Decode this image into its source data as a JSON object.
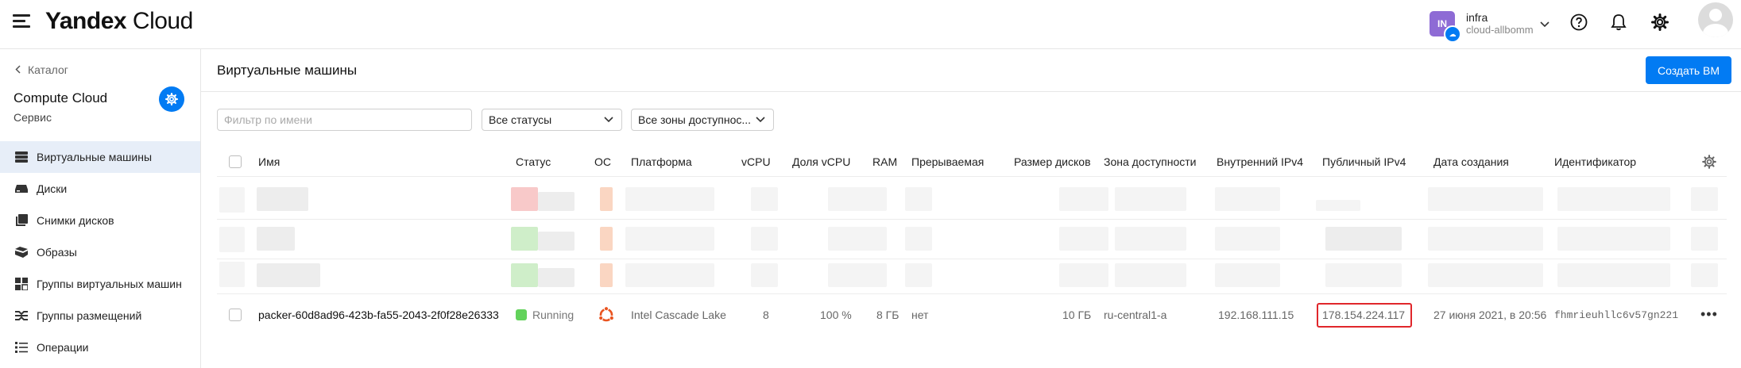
{
  "header": {
    "logo_bold": "Yandex",
    "logo_rest": " Cloud",
    "cloud_initials": "IN",
    "cloud_name": "infra",
    "cloud_id": "cloud-allbomm",
    "icons": [
      "help-icon",
      "bell-icon",
      "gear-icon"
    ]
  },
  "sidebar": {
    "back_label": "Каталог",
    "service_title": "Compute Cloud",
    "service_subtitle": "Сервис",
    "items": [
      {
        "label": "Виртуальные машины",
        "icon": "vm-icon",
        "active": true
      },
      {
        "label": "Диски",
        "icon": "disk-icon"
      },
      {
        "label": "Снимки дисков",
        "icon": "snapshot-icon"
      },
      {
        "label": "Образы",
        "icon": "image-icon"
      },
      {
        "label": "Группы виртуальных машин",
        "icon": "instance-group-icon"
      },
      {
        "label": "Группы размещений",
        "icon": "placement-group-icon"
      },
      {
        "label": "Операции",
        "icon": "operations-icon"
      }
    ]
  },
  "main": {
    "title": "Виртуальные машины",
    "create_button": "Создать ВМ",
    "filters": {
      "name_placeholder": "Фильтр по имени",
      "status_value": "Все статусы",
      "zone_value": "Все зоны доступнос..."
    },
    "table": {
      "columns": [
        "Имя",
        "Статус",
        "ОС",
        "Платформа",
        "vCPU",
        "Доля vCPU",
        "RAM",
        "Прерываемая",
        "Размер дисков",
        "Зона доступности",
        "Внутренний IPv4",
        "Публичный IPv4",
        "Дата создания",
        "Идентификатор"
      ],
      "row": {
        "name": "packer-60d8ad96-423b-fa55-2043-2f0f28e26333",
        "status": "Running",
        "os": "ubuntu-icon",
        "platform": "Intel Cascade Lake",
        "vcpu": "8",
        "vcpu_share": "100 %",
        "ram": "8 ГБ",
        "preemptible": "нет",
        "disk_size": "10 ГБ",
        "zone": "ru-central1-a",
        "internal_ip": "192.168.111.15",
        "public_ip": "178.154.224.117",
        "created": "27 июня 2021, в 20:56",
        "id": "fhmrieuhllc6v57gn221"
      }
    }
  },
  "colors": {
    "accent": "#027bf3",
    "running": "#62d25b",
    "highlight_border": "#e0262b",
    "active_nav": "#e7eef8"
  }
}
